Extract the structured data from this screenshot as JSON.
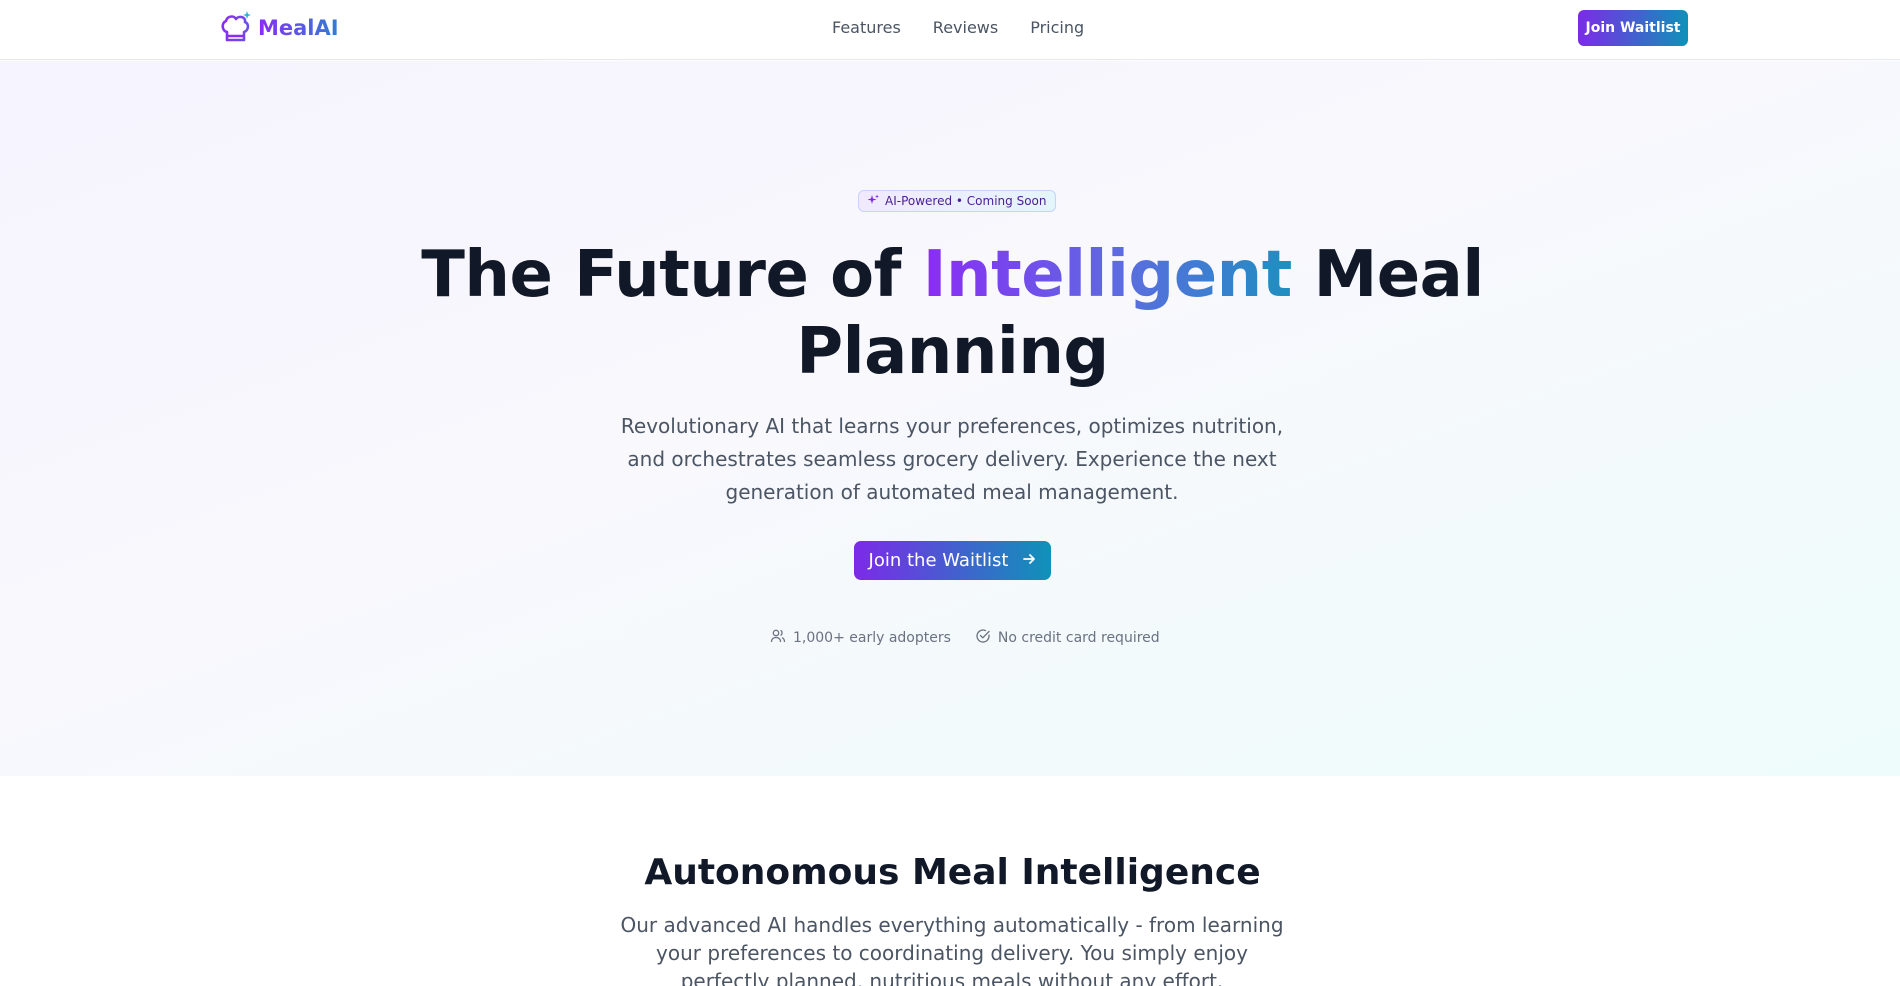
{
  "brand": {
    "name": "MealAI",
    "gradient": [
      "#8b2cf5",
      "#2f7fd0"
    ]
  },
  "nav": {
    "links": [
      "Features",
      "Reviews",
      "Pricing"
    ],
    "cta_label": "Join Waitlist"
  },
  "hero": {
    "badge": "AI-Powered • Coming Soon",
    "headline_before": "The Future of ",
    "headline_highlight": "Intelligent",
    "headline_after": " Meal Planning",
    "subtitle": "Revolutionary AI that learns your preferences, optimizes nutrition, and orchestrates seamless grocery delivery. Experience the next generation of automated meal management.",
    "cta_label": "Join the Waitlist",
    "meta": [
      {
        "icon": "users-icon",
        "text": "1,000+ early adopters"
      },
      {
        "icon": "check-circle-icon",
        "text": "No credit card required"
      }
    ]
  },
  "section": {
    "title": "Autonomous Meal Intelligence",
    "text": "Our advanced AI handles everything automatically - from learning your preferences to coordinating delivery. You simply enjoy perfectly planned, nutritious meals without any effort."
  },
  "colors": {
    "accent_purple": "#7c2ae8",
    "accent_teal": "#0f92b8",
    "text_dark": "#111827",
    "text_muted": "#4b5563"
  }
}
